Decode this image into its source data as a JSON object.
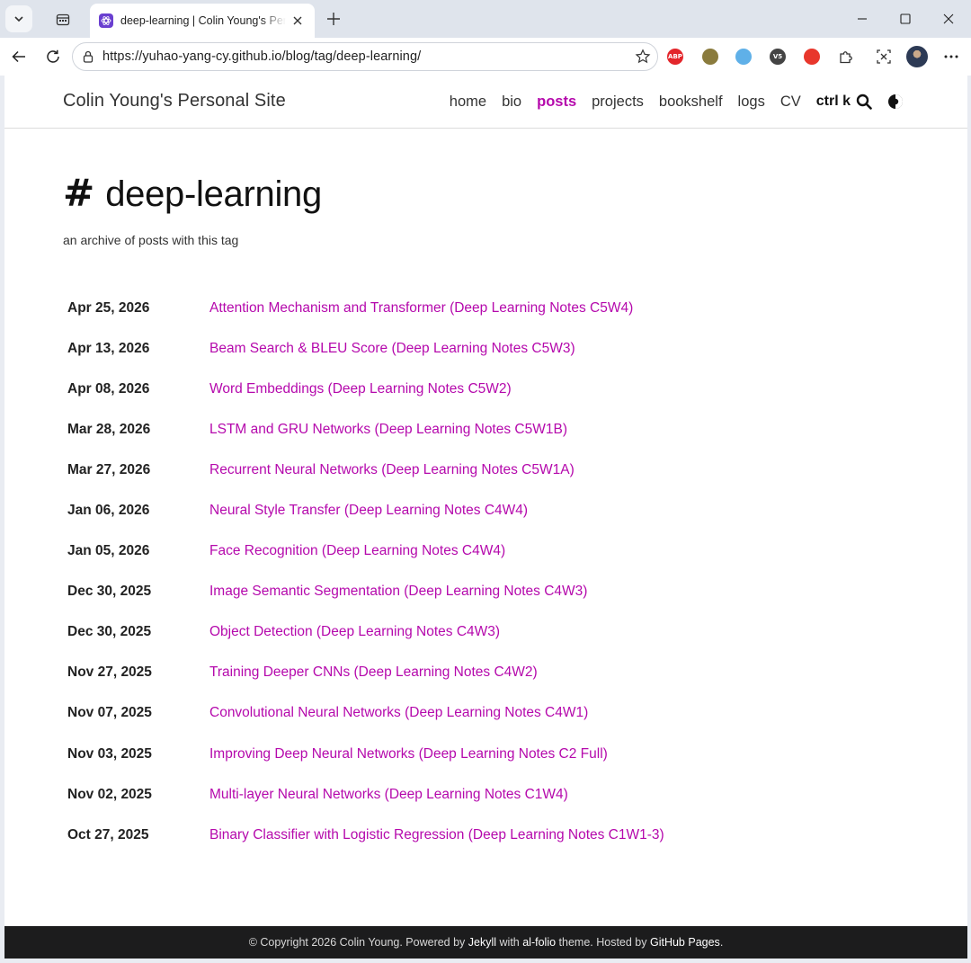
{
  "browser": {
    "tab_title": "deep-learning | Colin Young's Personal Site",
    "url": "https://yuhao-yang-cy.github.io/blog/tag/deep-learning/",
    "extensions": [
      {
        "name": "adblock-plus-icon",
        "color": "#e3262b",
        "label": "ABP"
      },
      {
        "name": "extension-icon-2",
        "color": "#8a7b3d",
        "label": ""
      },
      {
        "name": "extension-icon-3",
        "color": "#5fb0e8",
        "label": ""
      },
      {
        "name": "extension-icon-4",
        "color": "#444444",
        "label": "V5"
      },
      {
        "name": "extension-icon-5",
        "color": "#e8372c",
        "label": ""
      }
    ]
  },
  "site": {
    "title": "Colin Young's Personal Site",
    "nav": [
      {
        "label": "home",
        "active": false
      },
      {
        "label": "bio",
        "active": false
      },
      {
        "label": "posts",
        "active": true
      },
      {
        "label": "projects",
        "active": false
      },
      {
        "label": "bookshelf",
        "active": false
      },
      {
        "label": "logs",
        "active": false
      },
      {
        "label": "CV",
        "active": false
      }
    ],
    "search_label": "ctrl k",
    "accent_color": "#b509ac"
  },
  "tag_page": {
    "hash_symbol": "#",
    "tag": "deep-learning",
    "description": "an archive of posts with this tag"
  },
  "posts": [
    {
      "date": "Apr 25, 2026",
      "title": "Attention Mechanism and Transformer (Deep Learning Notes C5W4)"
    },
    {
      "date": "Apr 13, 2026",
      "title": "Beam Search & BLEU Score (Deep Learning Notes C5W3)"
    },
    {
      "date": "Apr 08, 2026",
      "title": "Word Embeddings (Deep Learning Notes C5W2)"
    },
    {
      "date": "Mar 28, 2026",
      "title": "LSTM and GRU Networks (Deep Learning Notes C5W1B)"
    },
    {
      "date": "Mar 27, 2026",
      "title": "Recurrent Neural Networks (Deep Learning Notes C5W1A)"
    },
    {
      "date": "Jan 06, 2026",
      "title": "Neural Style Transfer (Deep Learning Notes C4W4)"
    },
    {
      "date": "Jan 05, 2026",
      "title": "Face Recognition (Deep Learning Notes C4W4)"
    },
    {
      "date": "Dec 30, 2025",
      "title": "Image Semantic Segmentation (Deep Learning Notes C4W3)"
    },
    {
      "date": "Dec 30, 2025",
      "title": "Object Detection (Deep Learning Notes C4W3)"
    },
    {
      "date": "Nov 27, 2025",
      "title": "Training Deeper CNNs (Deep Learning Notes C4W2)"
    },
    {
      "date": "Nov 07, 2025",
      "title": "Convolutional Neural Networks (Deep Learning Notes C4W1)"
    },
    {
      "date": "Nov 03, 2025",
      "title": "Improving Deep Neural Networks (Deep Learning Notes C2 Full)"
    },
    {
      "date": "Nov 02, 2025",
      "title": "Multi-layer Neural Networks (Deep Learning Notes C1W4)"
    },
    {
      "date": "Oct 27, 2025",
      "title": "Binary Classifier with Logistic Regression (Deep Learning Notes C1W1-3)"
    }
  ],
  "footer": {
    "prefix": "© Copyright 2026 Colin Young. Powered by ",
    "jekyll": "Jekyll",
    "with": " with ",
    "theme": "al-folio",
    "hosted": " theme. Hosted by ",
    "host": "GitHub Pages",
    "suffix": "."
  }
}
